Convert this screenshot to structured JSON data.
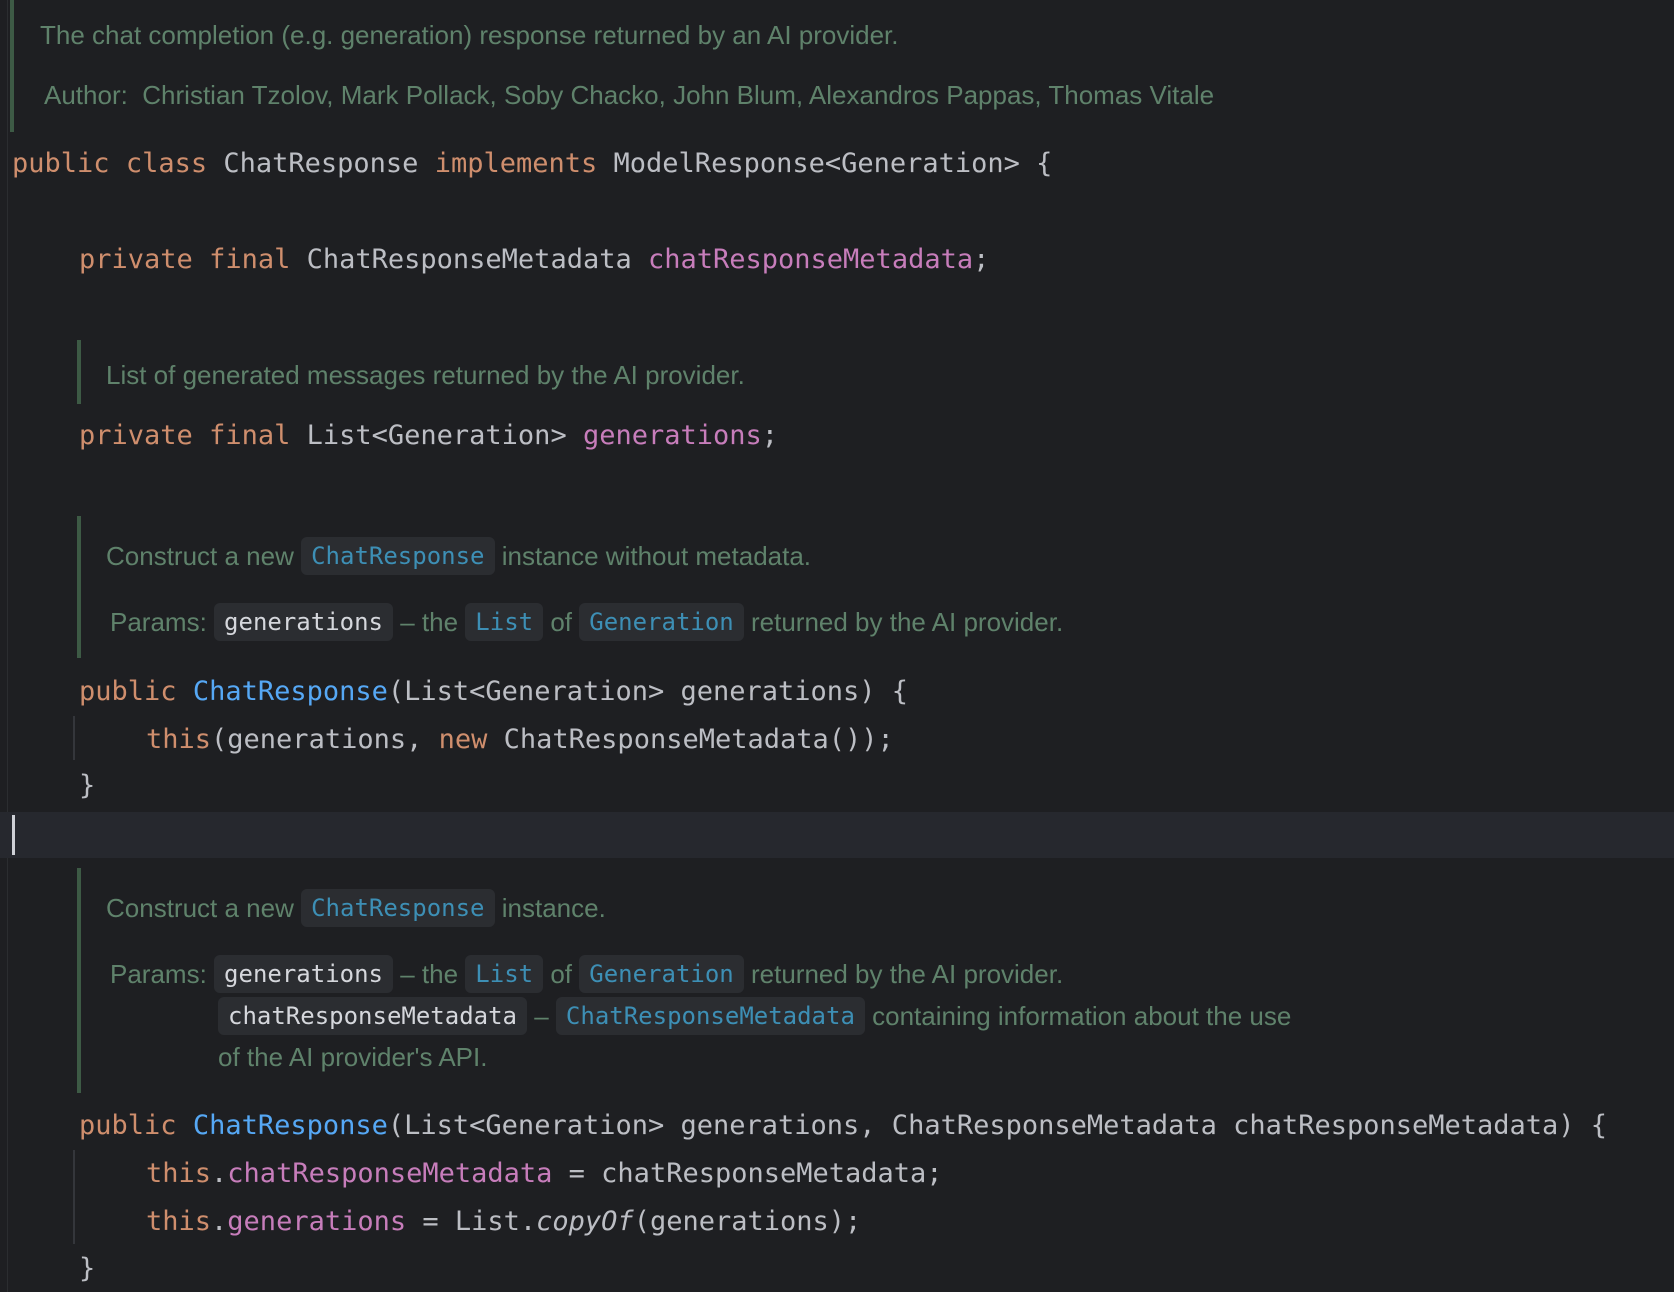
{
  "class_doc": {
    "summary": "The chat completion (e.g. generation) response returned by an AI provider.",
    "author_label": "Author:",
    "author_value": "Christian Tzolov, Mark Pollack, Soby Chacko, John Blum, Alexandros Pappas, Thomas Vitale"
  },
  "class_decl": {
    "kw_public": "public",
    "kw_class": "class",
    "name": "ChatResponse",
    "kw_implements": "implements",
    "iface": "ModelResponse<Generation> {"
  },
  "field1": {
    "kw_private": "private",
    "kw_final": "final",
    "type": "ChatResponseMetadata",
    "name": "chatResponseMetadata",
    "semi": ";"
  },
  "field2_doc": {
    "summary": "List of generated messages returned by the AI provider."
  },
  "field2": {
    "kw_private": "private",
    "kw_final": "final",
    "type": "List<Generation>",
    "name": "generations",
    "semi": ";"
  },
  "ctor1_doc": {
    "pre": "Construct a new",
    "link": "ChatResponse",
    "post": "instance without metadata.",
    "params_label": "Params:",
    "param_name": "generations",
    "dash_the": "– the",
    "list_link": "List",
    "of": "of",
    "gen_link": "Generation",
    "param_tail": "returned by the AI provider."
  },
  "ctor1": {
    "kw_public": "public",
    "name": "ChatResponse",
    "sig": "(List<Generation> generations) {",
    "kw_this": "this",
    "body_a": "(generations, ",
    "kw_new": "new",
    "body_b": " ChatResponseMetadata());",
    "close": "}"
  },
  "ctor2_doc": {
    "pre": "Construct a new",
    "link": "ChatResponse",
    "post": "instance.",
    "params_label": "Params:",
    "param1_name": "generations",
    "dash_the": "– the",
    "list_link": "List",
    "of": "of",
    "gen_link": "Generation",
    "param1_tail": "returned by the AI provider.",
    "param2_name": "chatResponseMetadata",
    "dash": "–",
    "meta_link": "ChatResponseMetadata",
    "param2_tail": "containing information about the use",
    "param2_cont": "of the AI provider's API."
  },
  "ctor2": {
    "kw_public": "public",
    "name": "ChatResponse",
    "sig": "(List<Generation> generations, ChatResponseMetadata chatResponseMetadata) {",
    "kw_this": "this",
    "dot": ".",
    "field_meta": "chatResponseMetadata",
    "assign_meta": " = chatResponseMetadata;",
    "field_gen": "generations",
    "assign_gen_a": " = List.",
    "copy_of": "copyOf",
    "assign_gen_b": "(generations);",
    "close": "}"
  }
}
